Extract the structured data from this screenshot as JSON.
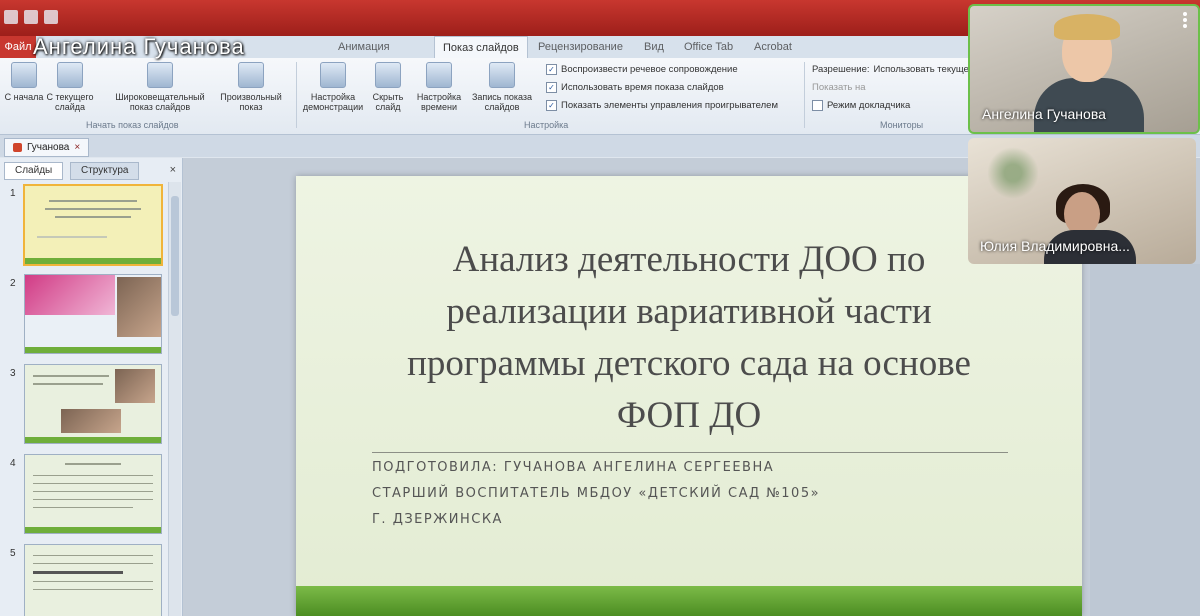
{
  "presenter_name": "Ангелина Гучанова",
  "ribbon_tabs": [
    "Файл",
    "Показ слайдов",
    "Анимация",
    "Рецензирование",
    "Вид",
    "Office Tab",
    "Acrobat"
  ],
  "ribbon_buttons": [
    "С начала",
    "С текущего слайда",
    "Широковещательный показ слайдов",
    "Произвольный показ",
    "Настройка демонстрации",
    "Скрыть слайд",
    "Настройка времени",
    "Запись показа слайдов"
  ],
  "ribbon_checks": [
    "Воспроизвести речевое сопровождение",
    "Использовать время показа слайдов",
    "Показать элементы управления проигрывателем"
  ],
  "monitor": {
    "resolution_label": "Разрешение:",
    "resolution_value": "Использовать текущее",
    "show_on": "Показать на",
    "presenter_view": "Режим докладчика"
  },
  "ribbon_groups": [
    "Начать показ слайдов",
    "Настройка",
    "Мониторы"
  ],
  "doc_tab": "Гучанова",
  "panel_tabs": [
    "Слайды",
    "Структура"
  ],
  "thumbnail_numbers": [
    "1",
    "2",
    "3",
    "4",
    "5"
  ],
  "slide": {
    "title_lines": [
      "Анализ деятельности ДОО по",
      "реализации вариативной части",
      "программы детского сада на основе",
      "ФОП ДО"
    ],
    "subtitle_lines": [
      "ПОДГОТОВИЛА: ГУЧАНОВА АНГЕЛИНА СЕРГЕЕВНА",
      "СТАРШИЙ ВОСПИТАТЕЛЬ МБДОУ «ДЕТСКИЙ САД №105»",
      "Г. ДЗЕРЖИНСКА"
    ]
  },
  "participants": [
    "Ангелина Гучанова",
    "Юлия Владимировна..."
  ],
  "colors": {
    "office_red": "#c8372f",
    "slide_green": "#6fae3a",
    "active_speaker": "#6cc04a"
  }
}
